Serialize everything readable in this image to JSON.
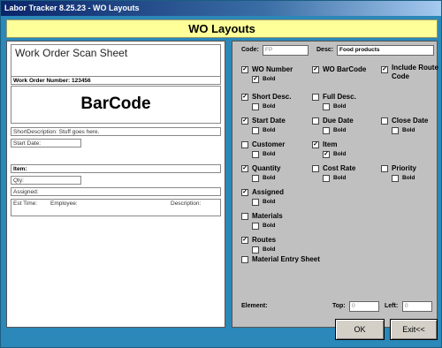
{
  "window": {
    "title": "Labor Tracker 8.25.23 - WO Layouts"
  },
  "header": {
    "title": "WO Layouts"
  },
  "preview": {
    "title": "Work Order Scan Sheet",
    "wo_number": "Work Order Number: 123456",
    "barcode": "BarCode",
    "short_desc": "ShortDescription: Stuff goes here.",
    "start_date": "Start Date:",
    "item": "Item:",
    "qty": "Qty:",
    "assigned": "Assigned:",
    "est_time": "Est Time:",
    "employee": "Employee:",
    "description": "Description:"
  },
  "options": {
    "code_label": "Code:",
    "code_value": "FP",
    "desc_label": "Desc:",
    "desc_value": "Food products",
    "bold_label": "Bold",
    "items": [
      {
        "label": "WO Number",
        "checked": true,
        "bold": true
      },
      {
        "label": "WO BarCode",
        "checked": true
      },
      {
        "label": "Include Route Code",
        "checked": true
      },
      {
        "label": "Short Desc.",
        "checked": true,
        "bold": false
      },
      {
        "label": "Full Desc.",
        "checked": false,
        "bold": false
      },
      {
        "label": "Start Date",
        "checked": true,
        "bold": false
      },
      {
        "label": "Due Date",
        "checked": false,
        "bold": false
      },
      {
        "label": "Close Date",
        "checked": false,
        "bold": false
      },
      {
        "label": "Customer",
        "checked": false,
        "bold": false
      },
      {
        "label": "Item",
        "checked": true,
        "bold": true
      },
      {
        "label": "Quantity",
        "checked": true,
        "bold": false
      },
      {
        "label": "Cost Rate",
        "checked": false,
        "bold": false
      },
      {
        "label": "Priority",
        "checked": false,
        "bold": false
      },
      {
        "label": "Assigned",
        "checked": true,
        "bold": false
      },
      {
        "label": "Materials",
        "checked": false,
        "bold": false
      },
      {
        "label": "Routes",
        "checked": true,
        "bold": false
      },
      {
        "label": "Material Entry Sheet",
        "checked": false
      }
    ]
  },
  "bottom": {
    "element_label": "Element:",
    "top_label": "Top:",
    "top_value": "0",
    "left_label": "Left:",
    "left_value": "0"
  },
  "buttons": {
    "ok": "OK",
    "exit": "Exit<<"
  },
  "colors": {
    "background": "#2b88b8",
    "header": "#ffff99",
    "panel": "#c0c0c0"
  }
}
